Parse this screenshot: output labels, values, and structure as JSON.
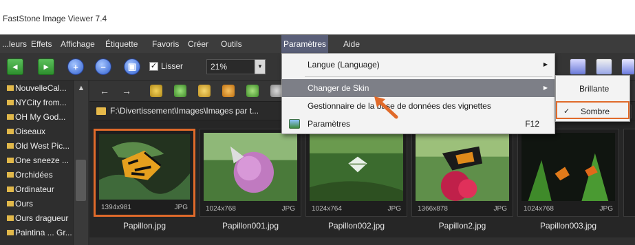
{
  "window": {
    "title": "FastStone Image Viewer 7.4"
  },
  "menubar": {
    "items": [
      "...leurs",
      "Effets",
      "Affichage",
      "Étiquette",
      "Favoris",
      "Créer",
      "Outils",
      "Paramètres",
      "Aide"
    ],
    "active": "Paramètres"
  },
  "toolbar": {
    "lisser_label": "Lisser",
    "lisser_checked": "✓",
    "zoom_value": "21%"
  },
  "sidebar": {
    "items": [
      "NouvelleCal...",
      "NYCity from...",
      "OH My God...",
      "Oiseaux",
      "Old West Pic...",
      "One sneeze ...",
      "Orchidées",
      "Ordinateur",
      "Ours",
      "Ours dragueur",
      "Paintina ... Gr..."
    ]
  },
  "pathbar": {
    "path": "F:\\Divertissement\\Images\\Images par t..."
  },
  "thumbnails": [
    {
      "dims": "1394x981",
      "format": "JPG",
      "name": "Papillon.jpg"
    },
    {
      "dims": "1024x768",
      "format": "JPG",
      "name": "Papillon001.jpg"
    },
    {
      "dims": "1024x764",
      "format": "JPG",
      "name": "Papillon002.jpg"
    },
    {
      "dims": "1366x878",
      "format": "JPG",
      "name": "Papillon2.jpg"
    },
    {
      "dims": "1024x768",
      "format": "JPG",
      "name": "Papillon003.jpg"
    }
  ],
  "parametres_menu": {
    "items": [
      {
        "label": "Langue (Language)"
      },
      {
        "label": "Changer de Skin"
      },
      {
        "label": "Gestionnaire de la base de données des vignettes"
      },
      {
        "label": "Paramètres",
        "shortcut": "F12"
      }
    ]
  },
  "skin_submenu": {
    "items": [
      {
        "label": "Brillante",
        "check": ""
      },
      {
        "label": "Sombre",
        "check": "✓"
      }
    ]
  },
  "colors": {
    "highlight": "#e06a2a",
    "menu_active": "#5a5f78",
    "dark_bg": "#2e2e2e"
  }
}
